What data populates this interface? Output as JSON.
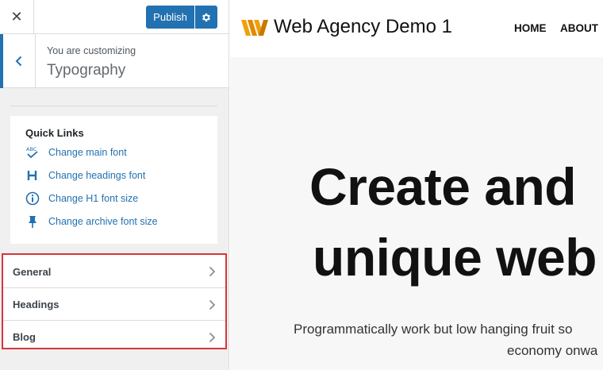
{
  "topbar": {
    "close_icon": "close-icon",
    "publish_label": "Publish",
    "settings_icon": "gear-icon"
  },
  "customizer": {
    "customizing_label": "You are customizing",
    "section_title": "Typography",
    "back_icon": "chevron-left-icon"
  },
  "quick_links": {
    "title": "Quick Links",
    "items": [
      {
        "label": "Change main font",
        "icon": "spellcheck-icon"
      },
      {
        "label": "Change headings font",
        "icon": "heading-icon"
      },
      {
        "label": "Change H1 font size",
        "icon": "info-icon"
      },
      {
        "label": "Change archive font size",
        "icon": "pin-icon"
      }
    ]
  },
  "settings": {
    "items": [
      {
        "label": "General"
      },
      {
        "label": "Headings"
      },
      {
        "label": "Blog"
      }
    ]
  },
  "preview": {
    "site_name": "Web Agency Demo 1",
    "nav": [
      "HOME",
      "ABOUT"
    ],
    "hero_line_1": "Create and",
    "hero_line_2": "unique web",
    "subtitle_line_1": "Programmatically work but low hanging fruit so",
    "subtitle_line_2": "economy onwa"
  },
  "colors": {
    "accent": "#2271b1",
    "highlight_border": "#d63638",
    "logo_orange": "#f0a00a"
  }
}
